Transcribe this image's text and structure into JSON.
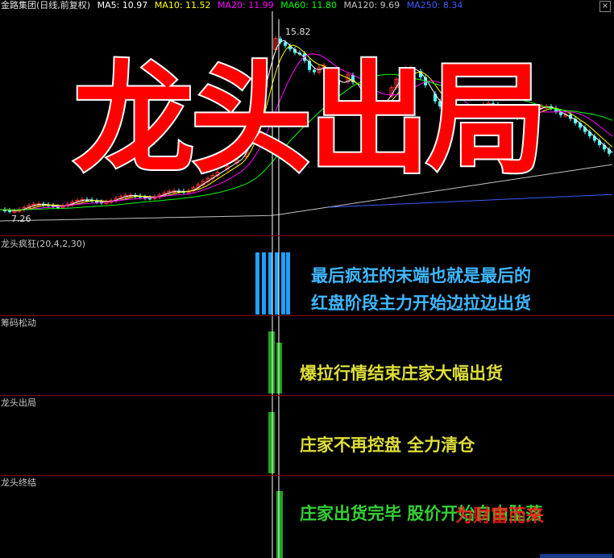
{
  "header": {
    "stock": "金路集团(日线,前复权)",
    "ma5": "MA5: 10.97",
    "ma10": "MA10: 11.52",
    "ma20": "MA20: 11.99",
    "ma60": "MA60: 11.80",
    "ma120": "MA120: 9.69",
    "ma250": "MA250: 8.34"
  },
  "main_chart": {
    "peak_label": "15.82",
    "low_label": "7.26",
    "big_title": "龙头出局"
  },
  "panels": [
    {
      "label": "龙头疯狂(20,4,2,30)",
      "lines": [
        "最后疯狂的末端也就是最后的",
        "红盘阶段主力开始边拉边出货"
      ]
    },
    {
      "label": "筹码松动",
      "lines": [
        "爆拉行情结束庄家大幅出货"
      ]
    },
    {
      "label": "龙头出局",
      "lines": [
        "庄家不再控盘  全力清仓"
      ]
    },
    {
      "label": "龙头终结",
      "lines": [
        "庄家出货完毕  股价开始自由坠落"
      ]
    }
  ],
  "watermark": "为财富而来",
  "colors": {
    "ma5": "#ffffff",
    "ma10": "#ffff00",
    "ma20": "#ff00ff",
    "ma60": "#00ff00",
    "ma120": "#c0c0c0",
    "ma250": "#3a5bff",
    "up_candle": "#ff3232",
    "down_candle": "#54ffff",
    "cyan_bars": "#1ea0ff",
    "green_bars": "#1fa41f",
    "title_red": "#ff0000",
    "panel_sep": "#8b0000"
  },
  "icons": {
    "close": "close-icon"
  }
}
